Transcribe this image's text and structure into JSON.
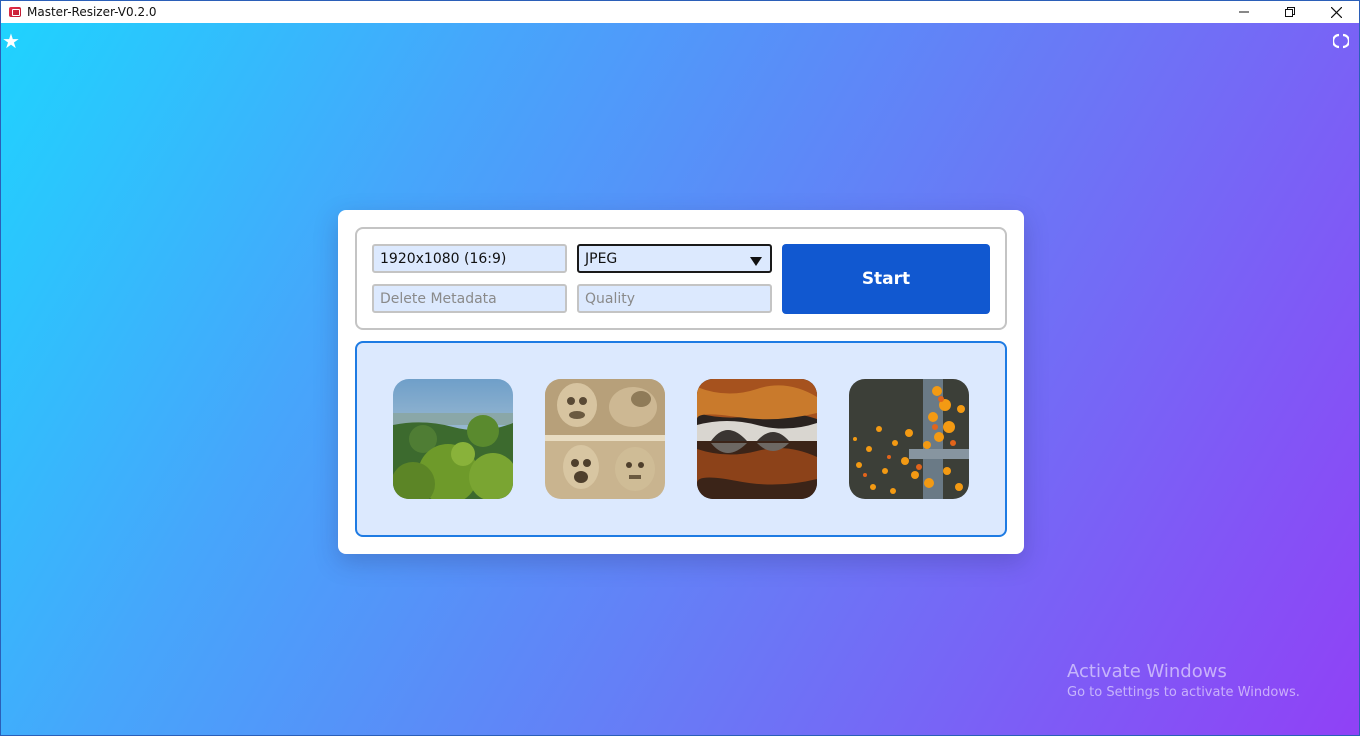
{
  "window": {
    "title": "Master-Resizer-V0.2.0",
    "minimize_glyph": "—",
    "restore_glyph": "❐",
    "close_glyph": "✕"
  },
  "toolbar": {
    "left_icon": "star-icon",
    "right_icon": "refresh-icon"
  },
  "controls": {
    "resolution_value": "1920x1080 (16:9)",
    "format_value": "JPEG",
    "metadata_placeholder": "Delete Metadata",
    "quality_placeholder": "Quality",
    "start_label": "Start"
  },
  "images": [
    {
      "name": "image-thumbnail-forest"
    },
    {
      "name": "image-thumbnail-carvings"
    },
    {
      "name": "image-thumbnail-bridge"
    },
    {
      "name": "image-thumbnail-flowers"
    }
  ],
  "watermark": {
    "title": "Activate Windows",
    "subtitle": "Go to Settings to activate Windows."
  },
  "colors": {
    "accent": "#1158d0",
    "field_bg": "#dce9fe",
    "images_border": "#1e7be3"
  }
}
